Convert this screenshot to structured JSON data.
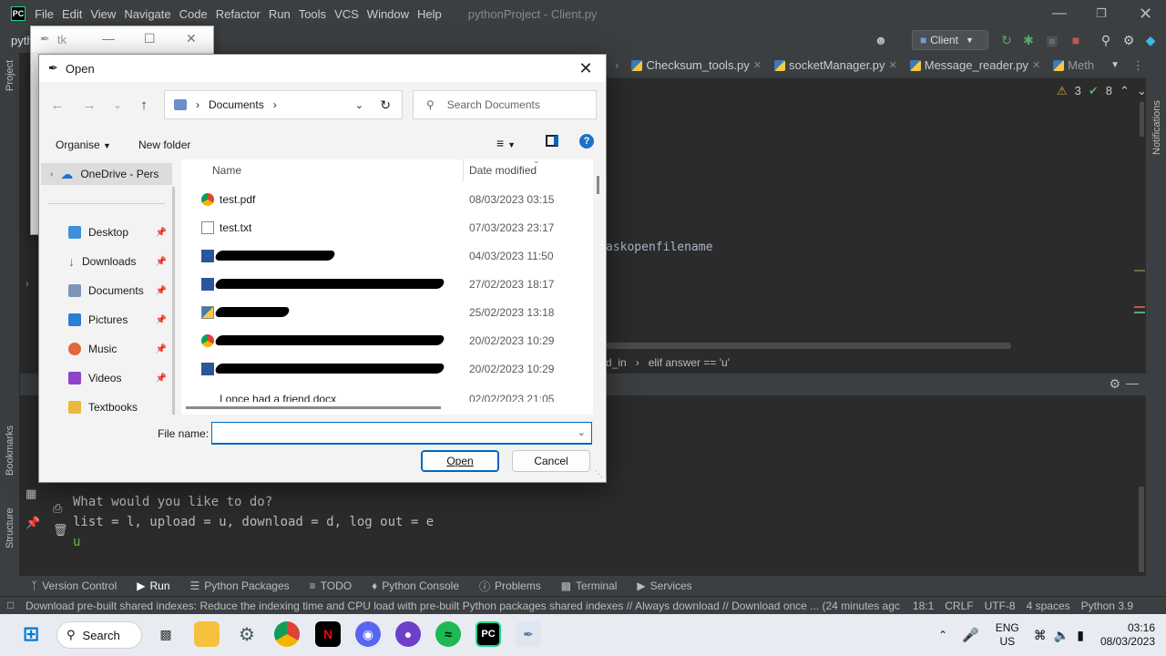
{
  "ide": {
    "menu": [
      "File",
      "Edit",
      "View",
      "Navigate",
      "Code",
      "Refactor",
      "Run",
      "Tools",
      "VCS",
      "Window",
      "Help"
    ],
    "window_title": "pythonProject - Client.py",
    "logo_text": "PC",
    "project_crumb": "pyth",
    "run_config": "Client",
    "editor_tabs": [
      "Checksum_tools.py",
      "socketManager.py",
      "Message_reader.py",
      "Meth"
    ],
    "inspections": {
      "warnings": "3",
      "ok": "8"
    },
    "code_fragment": "askopenfilename",
    "editor_breadcrumb": [
      "d_in",
      "elif answer == 'u'"
    ],
    "left_tools": [
      "Project",
      "Bookmarks",
      "Structure"
    ],
    "right_tools": [
      "Notifications"
    ],
    "run_label": "Ru",
    "console": {
      "line1": "What would you like to do?",
      "line2": "list = l, upload = u, download = d, log out = e",
      "input": "u"
    },
    "bottom_tools": [
      "Version Control",
      "Run",
      "Python Packages",
      "TODO",
      "Python Console",
      "Problems",
      "Terminal",
      "Services"
    ],
    "status_message": "Download pre-built shared indexes: Reduce the indexing time and CPU load with pre-built Python packages shared indexes // Always download // Download once ... (24 minutes agc",
    "status_right": [
      "18:1",
      "CRLF",
      "UTF-8",
      "4 spaces",
      "Python 3.9"
    ]
  },
  "tk_window": {
    "title": "tk"
  },
  "dialog": {
    "title": "Open",
    "address": "Documents",
    "search_placeholder": "Search Documents",
    "organise": "Organise",
    "new_folder": "New folder",
    "nav_onedrive": "OneDrive - Pers",
    "nav_items": [
      "Desktop",
      "Downloads",
      "Documents",
      "Pictures",
      "Music",
      "Videos",
      "Textbooks"
    ],
    "col_name": "Name",
    "col_date": "Date modified",
    "files": [
      {
        "name": "test.pdf",
        "date": "08/03/2023 03:15",
        "icon": "chrome-icon"
      },
      {
        "name": "test.txt",
        "date": "07/03/2023 23:17",
        "icon": "text-file-icon"
      },
      {
        "name": "",
        "date": "04/03/2023 11:50",
        "icon": "word-icon"
      },
      {
        "name": "",
        "date": "27/02/2023 18:17",
        "icon": "word-icon"
      },
      {
        "name": "",
        "date": "25/02/2023 13:18",
        "icon": "python-file-icon"
      },
      {
        "name": "",
        "date": "20/02/2023 10:29",
        "icon": "chrome-icon"
      },
      {
        "name": "",
        "date": "20/02/2023 10:29",
        "icon": "word-icon"
      },
      {
        "name": "I once had a friend.docx",
        "date": "02/02/2023 21:05",
        "icon": "word-icon"
      }
    ],
    "file_name_label": "File name:",
    "file_name_value": "",
    "open_label": "Open",
    "cancel_label": "Cancel"
  },
  "taskbar": {
    "search_label": "Search",
    "lang": "ENG",
    "region": "US",
    "time": "03:16",
    "date": "08/03/2023"
  }
}
